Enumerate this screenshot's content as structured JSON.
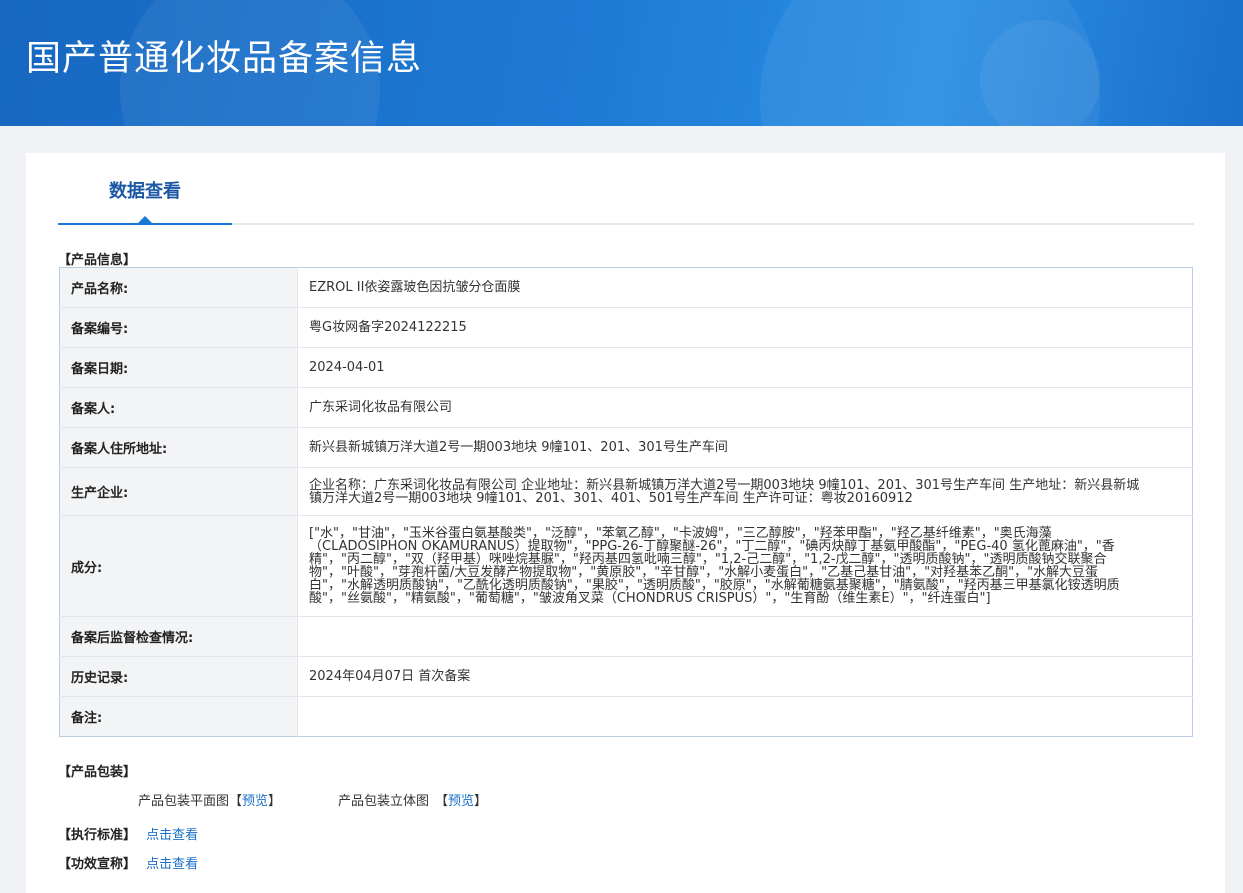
{
  "header": {
    "title": "国产普通化妆品备案信息"
  },
  "tabs": {
    "active_label": "数据查看"
  },
  "sections": {
    "product_info": "【产品信息】",
    "product_packaging": "【产品包装】",
    "execution_standard": "【执行标准】",
    "efficacy_claim": "【功效宣称】"
  },
  "product_info": {
    "rows": [
      {
        "label": "产品名称:",
        "value": "EZROL II依姿露玻色因抗皱分仓面膜"
      },
      {
        "label": "备案编号:",
        "value": "粤G妆网备字2024122215"
      },
      {
        "label": "备案日期:",
        "value": "2024-04-01"
      },
      {
        "label": "备案人:",
        "value": "广东采词化妆品有限公司"
      },
      {
        "label": "备案人住所地址:",
        "value": "新兴县新城镇万洋大道2号一期003地块 9幢101、201、301号生产车间"
      },
      {
        "label": "生产企业:",
        "value": "企业名称：广东采词化妆品有限公司 企业地址：新兴县新城镇万洋大道2号一期003地块 9幢101、201、301号生产车间 生产地址：新兴县新城镇万洋大道2号一期003地块 9幢101、201、301、401、501号生产车间 生产许可证：粤妆20160912"
      },
      {
        "label": "成分:",
        "value": "[\"水\"，\"甘油\"，\"玉米谷蛋白氨基酸类\"，\"泛醇\"，\"苯氧乙醇\"，\"卡波姆\"，\"三乙醇胺\"，\"羟苯甲酯\"，\"羟乙基纤维素\"，\"奥氏海藻（CLADOSIPHON OKAMURANUS）提取物\"，\"PPG-26-丁醇聚醚-26\"，\"丁二醇\"，\"碘丙炔醇丁基氨甲酸酯\"，\"PEG-40 氢化蓖麻油\"，\"香精\"，\"丙二醇\"，\"双（羟甲基）咪唑烷基脲\"，\"羟丙基四氢吡喃三醇\"，\"1,2-己二醇\"，\"1,2-戊二醇\"，\"透明质酸钠\"，\"透明质酸钠交联聚合物\"，\"叶酸\"，\"芽孢杆菌/大豆发酵产物提取物\"，\"黄原胶\"，\"辛甘醇\"，\"水解小麦蛋白\"，\"乙基己基甘油\"，\"对羟基苯乙酮\"，\"水解大豆蛋白\"，\"水解透明质酸钠\"，\"乙酰化透明质酸钠\"，\"果胶\"，\"透明质酸\"，\"胶原\"，\"水解葡糖氨基聚糖\"，\"腈氨酸\"，\"羟丙基三甲基氯化铵透明质酸\"，\"丝氨酸\"，\"精氨酸\"，\"葡萄糖\"，\"皱波角叉菜（CHONDRUS CRISPUS）\"，\"生育酚（维生素E）\"，\"纤连蛋白\"]"
      },
      {
        "label": "备案后监督检查情况:",
        "value": ""
      },
      {
        "label": "历史记录:",
        "value": "2024年04月07日 首次备案"
      },
      {
        "label": "备注:",
        "value": ""
      }
    ]
  },
  "packaging": {
    "flat_label": "产品包装平面图",
    "flat_link": "预览",
    "solid_label": "产品包装立体图",
    "solid_link": "预览",
    "bracket_open": "【",
    "bracket_close": "】"
  },
  "links": {
    "standard_view": "点击查看",
    "efficacy_view": "点击查看"
  },
  "colors": {
    "header_bg": "#1d79d3",
    "accent": "#1a78d0",
    "tab_text": "#1e58a5",
    "link": "#1a6fc7"
  }
}
